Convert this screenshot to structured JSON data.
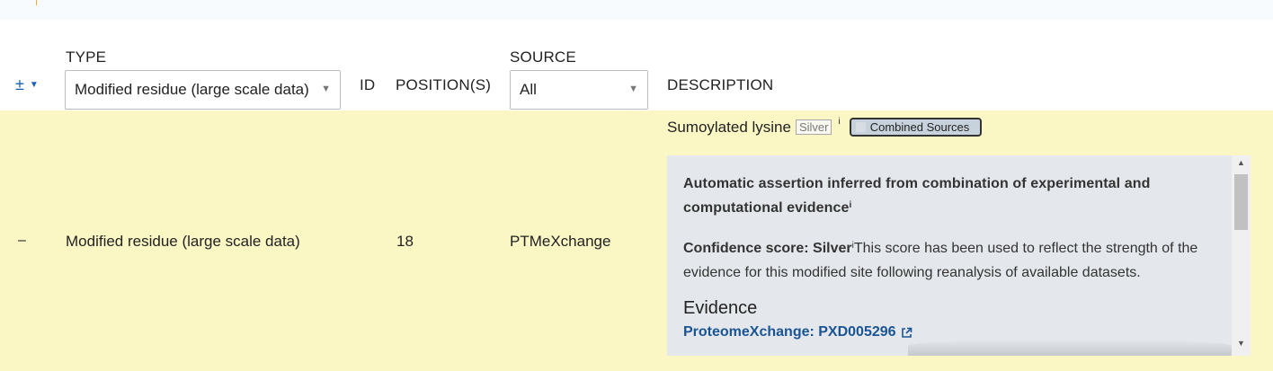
{
  "header": {
    "expand_icon": "plus-minus-icon",
    "type_label": "TYPE",
    "type_select_value": "Modified residue (large scale data)",
    "id_label": "ID",
    "positions_label": "POSITION(S)",
    "source_label": "SOURCE",
    "source_select_value": "All",
    "description_label": "DESCRIPTION"
  },
  "row": {
    "collapse_symbol": "–",
    "type": "Modified residue (large scale data)",
    "id": "",
    "position": "18",
    "source": "PTMeXchange",
    "description": {
      "title": "Sumoylated lysine",
      "badge": "Silver",
      "info": "i",
      "combined_sources": "Combined Sources",
      "panel": {
        "assertion": "Automatic assertion inferred from combination of experimental and computational evidence",
        "assertion_sup": "i",
        "confidence_label": "Confidence score: Silver",
        "confidence_sup": "i",
        "confidence_text": "This score has been used to reflect the strength of the evidence for this modified site following reanalysis of available datasets.",
        "evidence_title": "Evidence",
        "evidence_link": "ProteomeXchange: PXD005296"
      }
    }
  },
  "colors": {
    "row_highlight": "#faf7c4",
    "panel_bg": "#e4e8ec",
    "link": "#1a5494",
    "accent_blue": "#1a5fb4"
  }
}
